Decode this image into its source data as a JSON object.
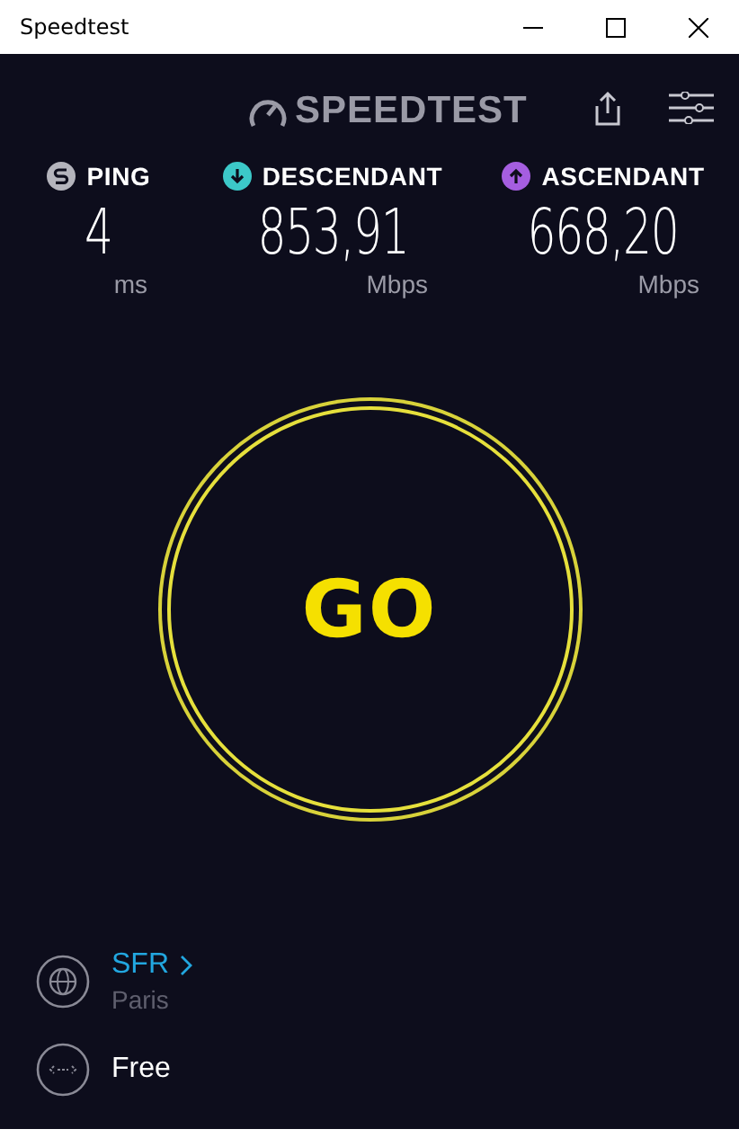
{
  "window": {
    "title": "Speedtest"
  },
  "header": {
    "logo": "SPEEDTEST"
  },
  "stats": [
    {
      "kind": "ping",
      "label": "PING",
      "value": "4",
      "unit": "ms",
      "color": "#b4b4bc"
    },
    {
      "kind": "download",
      "label": "DESCENDANT",
      "value": "853,91",
      "unit": "Mbps",
      "color": "#3cc8c8"
    },
    {
      "kind": "upload",
      "label": "ASCENDANT",
      "value": "668,20",
      "unit": "Mbps",
      "color": "#a55ee0"
    }
  ],
  "go_button": {
    "label": "GO"
  },
  "server": {
    "name": "SFR",
    "location": "Paris"
  },
  "provider": {
    "name": "Free"
  }
}
